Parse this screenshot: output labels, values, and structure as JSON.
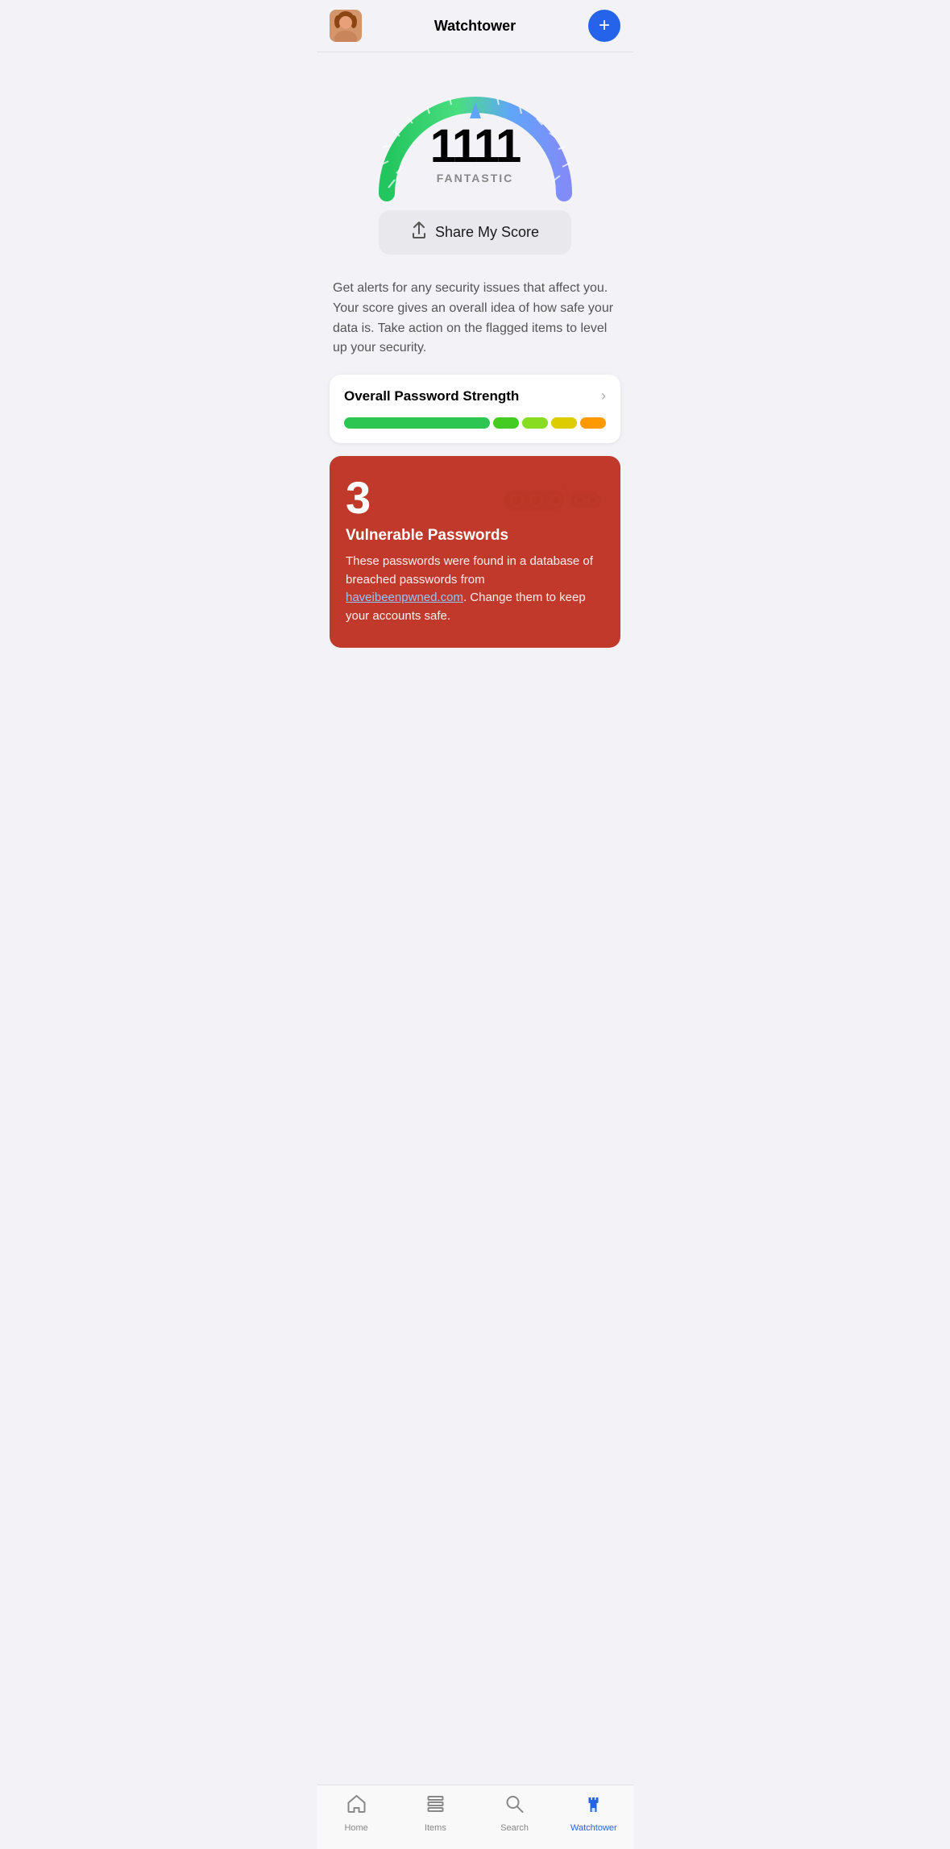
{
  "header": {
    "title": "Watchtower",
    "add_button_label": "+",
    "avatar_alt": "User avatar"
  },
  "gauge": {
    "score": "1111",
    "label": "FANTASTIC",
    "needle_angle": 90
  },
  "share_button": {
    "label": "Share My Score",
    "icon": "share"
  },
  "description": {
    "text": "Get alerts for any security issues that affect you. Your score gives an overall idea of how safe your data is. Take action on the flagged items to level up your security."
  },
  "password_strength": {
    "title": "Overall Password Strength",
    "bars": [
      {
        "color": "#2dc653",
        "type": "long"
      },
      {
        "color": "#44cc44",
        "type": "short"
      },
      {
        "color": "#88dd22",
        "type": "short"
      },
      {
        "color": "#ddcc00",
        "type": "short"
      },
      {
        "color": "#ff9900",
        "type": "short"
      }
    ]
  },
  "vulnerable_passwords": {
    "count": "3",
    "title": "Vulnerable Passwords",
    "description_start": "These passwords were found in a database of breached passwords from ",
    "link_text": "haveibeenpwned.com",
    "link_url": "https://haveibeenpwned.com",
    "description_end": ". Change them to keep your accounts safe."
  },
  "bottom_nav": {
    "items": [
      {
        "label": "Home",
        "icon": "home",
        "active": false
      },
      {
        "label": "Items",
        "icon": "items",
        "active": false
      },
      {
        "label": "Search",
        "icon": "search",
        "active": false
      },
      {
        "label": "Watchtower",
        "icon": "watchtower",
        "active": true
      }
    ]
  }
}
